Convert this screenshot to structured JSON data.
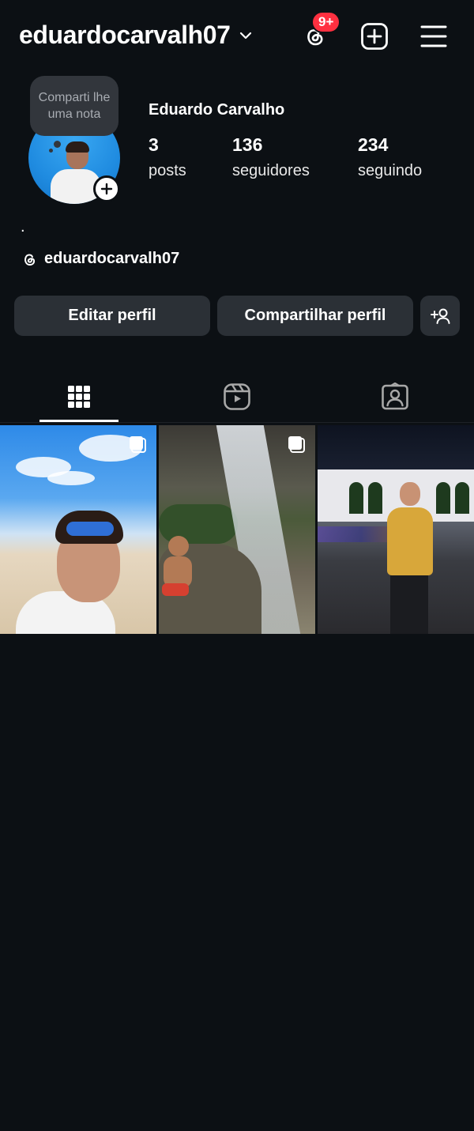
{
  "header": {
    "username": "eduardocarvalh07",
    "notification_badge": "9+",
    "badge_color": "#ff3040"
  },
  "note": {
    "placeholder": "Comparti lhe uma nota"
  },
  "profile": {
    "full_name": "Eduardo Carvalho",
    "bio": ".",
    "threads_handle": "eduardocarvalh07",
    "stats": {
      "posts_count": "3",
      "posts_label": "posts",
      "followers_count": "136",
      "followers_label": "seguidores",
      "following_count": "234",
      "following_label": "seguindo"
    }
  },
  "actions": {
    "edit_label": "Editar perfil",
    "share_label": "Compartilhar perfil"
  },
  "tabs": [
    {
      "name": "grid",
      "icon": "grid-icon",
      "active": true
    },
    {
      "name": "reels",
      "icon": "reels-icon",
      "active": false
    },
    {
      "name": "tagged",
      "icon": "tagged-icon",
      "active": false
    }
  ],
  "posts": [
    {
      "description_icon": "multi-photo-icon",
      "carousel": true
    },
    {
      "description_icon": "multi-photo-icon",
      "carousel": true
    },
    {
      "description_icon": "",
      "carousel": false
    }
  ],
  "colors": {
    "background": "#0c1014",
    "button_bg": "#2b3036",
    "note_bg": "#32363c"
  }
}
